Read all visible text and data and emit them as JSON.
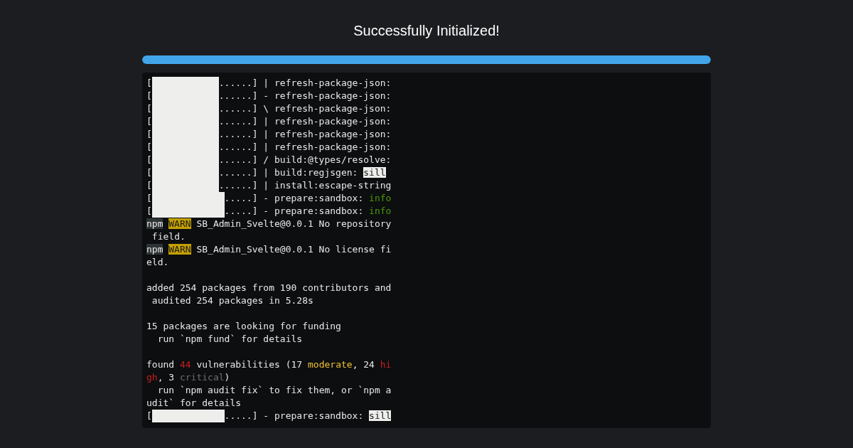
{
  "title": "Successfully Initialized!",
  "progress": {
    "level": 1
  },
  "terminal": {
    "rows": [
      {
        "kind": "progress",
        "open": "[",
        "wide": false,
        "rest": "......] | refresh-package-json:"
      },
      {
        "kind": "progress",
        "open": "[",
        "wide": false,
        "rest": "......] - refresh-package-json:"
      },
      {
        "kind": "progress",
        "open": "[",
        "wide": false,
        "rest": "......] \\ refresh-package-json:"
      },
      {
        "kind": "progress",
        "open": "[",
        "wide": false,
        "rest": "......] | refresh-package-json:"
      },
      {
        "kind": "progress",
        "open": "[",
        "wide": false,
        "rest": "......] | refresh-package-json:"
      },
      {
        "kind": "progress",
        "open": "[",
        "wide": false,
        "rest": "......] | refresh-package-json:"
      },
      {
        "kind": "progress",
        "open": "[",
        "wide": false,
        "rest": "......] / build:@types/resolve:"
      },
      {
        "kind": "progress",
        "open": "[",
        "wide": false,
        "rest": "......] | build:regjsgen: ",
        "tag": {
          "kind": "sill",
          "text": "sill"
        }
      },
      {
        "kind": "progress",
        "open": "[",
        "wide": false,
        "rest": "......] | install:escape-string"
      },
      {
        "kind": "progress",
        "open": "[",
        "wide": true,
        "rest": ".....] - prepare:sandbox: ",
        "tag": {
          "kind": "info",
          "text": "info"
        }
      },
      {
        "kind": "progress",
        "open": "[",
        "wide": true,
        "rest": ".....] - prepare:sandbox: ",
        "tag": {
          "kind": "info",
          "text": "info"
        }
      },
      {
        "kind": "text",
        "segments": [
          {
            "kind": "npm",
            "text": "npm"
          },
          {
            "kind": "warn",
            "text": "WARN"
          },
          {
            "kind": "plain",
            "text": " SB_Admin_Svelte@0.0.1 No repository"
          }
        ]
      },
      {
        "kind": "text",
        "segments": [
          {
            "kind": "plain",
            "text": " field."
          }
        ]
      },
      {
        "kind": "text",
        "segments": [
          {
            "kind": "npm",
            "text": "npm"
          },
          {
            "kind": "warn",
            "text": "WARN"
          },
          {
            "kind": "plain",
            "text": " SB_Admin_Svelte@0.0.1 No license fi"
          }
        ]
      },
      {
        "kind": "text",
        "segments": [
          {
            "kind": "plain",
            "text": "eld."
          }
        ]
      },
      {
        "kind": "blank"
      },
      {
        "kind": "text",
        "segments": [
          {
            "kind": "plain",
            "text": "added 254 packages from 190 contributors and"
          }
        ]
      },
      {
        "kind": "text",
        "segments": [
          {
            "kind": "plain",
            "text": " audited 254 packages in 5.28s"
          }
        ]
      },
      {
        "kind": "blank"
      },
      {
        "kind": "text",
        "segments": [
          {
            "kind": "plain",
            "text": "15 packages are looking for funding"
          }
        ]
      },
      {
        "kind": "text",
        "segments": [
          {
            "kind": "plain",
            "text": "  run `npm fund` for details"
          }
        ]
      },
      {
        "kind": "blank"
      },
      {
        "kind": "text",
        "segments": [
          {
            "kind": "plain",
            "text": "found "
          },
          {
            "kind": "red",
            "text": "44"
          },
          {
            "kind": "plain",
            "text": " vulnerabilities (17 "
          },
          {
            "kind": "yellow",
            "text": "moderate"
          },
          {
            "kind": "plain",
            "text": ", 24 "
          },
          {
            "kind": "red",
            "text": "hi"
          }
        ]
      },
      {
        "kind": "text",
        "segments": [
          {
            "kind": "red",
            "text": "gh"
          },
          {
            "kind": "plain",
            "text": ", 3 "
          },
          {
            "kind": "gray",
            "text": "critical"
          },
          {
            "kind": "plain",
            "text": ")"
          }
        ]
      },
      {
        "kind": "text",
        "segments": [
          {
            "kind": "plain",
            "text": "  run `npm audit fix` to fix them, or `npm a"
          }
        ]
      },
      {
        "kind": "text",
        "segments": [
          {
            "kind": "plain",
            "text": "udit` for details"
          }
        ]
      },
      {
        "kind": "progress",
        "open": "[",
        "wide": true,
        "rest": ".....] - prepare:sandbox: ",
        "tag": {
          "kind": "sill",
          "text": "sill"
        }
      }
    ]
  }
}
